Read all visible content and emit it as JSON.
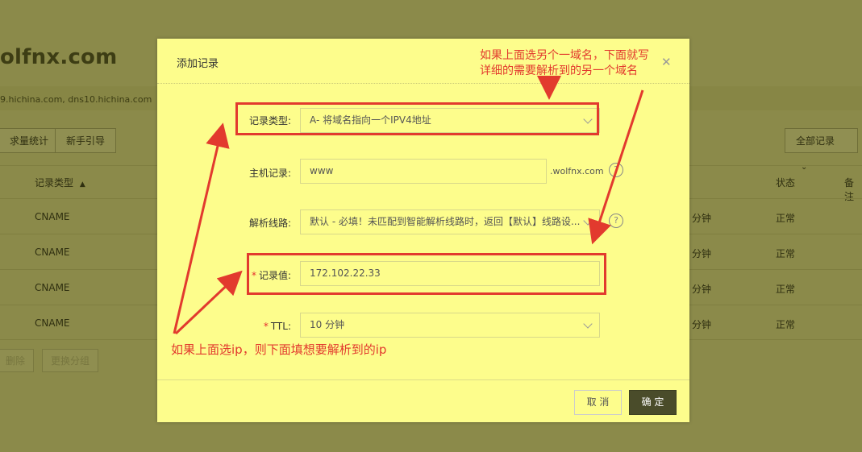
{
  "background": {
    "domain_title": "olfnx.com",
    "dns_servers": "9.hichina.com, dns10.hichina.com",
    "buttons": [
      "求量统计",
      "新手引导"
    ],
    "filter_dropdown": "全部记录",
    "table_headers": {
      "record_type": "记录类型",
      "status": "状态",
      "remark": "备注"
    },
    "rows": [
      {
        "type": "CNAME",
        "ttl": "分钟",
        "status": "正常"
      },
      {
        "type": "CNAME",
        "ttl": "分钟",
        "status": "正常"
      },
      {
        "type": "CNAME",
        "ttl": "分钟",
        "status": "正常"
      },
      {
        "type": "CNAME",
        "ttl": "分钟",
        "status": "正常"
      }
    ],
    "footer_buttons": [
      "删除",
      "更换分组"
    ]
  },
  "modal": {
    "title": "添加记录",
    "close_icon": "close-icon",
    "fields": {
      "record_type": {
        "label": "记录类型:",
        "value": "A- 将域名指向一个IPV4地址"
      },
      "host": {
        "label": "主机记录:",
        "value": "www",
        "suffix": ".wolfnx.com"
      },
      "line": {
        "label": "解析线路:",
        "value": "默认 - 必填！未匹配到智能解析线路时，返回【默认】线路设..."
      },
      "record_value": {
        "label": "记录值:",
        "value": "172.102.22.33",
        "required": "*"
      },
      "ttl": {
        "label": "TTL:",
        "value": "10 分钟",
        "required": "*"
      }
    },
    "cancel_label": "取 消",
    "ok_label": "确 定"
  },
  "annotations": {
    "top_line1": "如果上面选另个一域名，下面就写",
    "top_line2": "详细的需要解析到的另一个域名",
    "bottom": "如果上面选ip，则下面填想要解析到的ip",
    "color": "#e23a2e"
  },
  "colors": {
    "modal_bg": "#fdfd8c",
    "overlay_bg": "#8b8a4a",
    "ok_button": "#4a4c2a"
  }
}
